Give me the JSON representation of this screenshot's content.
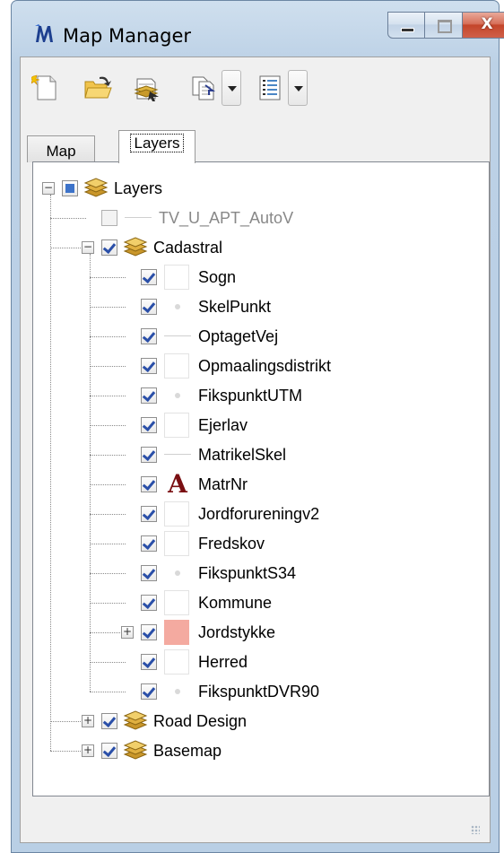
{
  "window": {
    "title": "Map Manager",
    "logo_icon": "map-manager-logo-icon",
    "caption_buttons": [
      "minimize",
      "maximize",
      "close"
    ],
    "close_glyph": "X"
  },
  "toolbar": {
    "buttons": [
      {
        "name": "new-map-icon"
      },
      {
        "name": "open-folder-icon"
      },
      {
        "name": "load-layer-icon"
      },
      {
        "name": "copy-document-icon",
        "has_dropdown": true
      },
      {
        "name": "list-view-icon",
        "has_dropdown": true
      }
    ]
  },
  "tabs": [
    {
      "label": "Map",
      "selected": false
    },
    {
      "label": "Layers",
      "selected": true
    }
  ],
  "tree": {
    "nodes": [
      {
        "label": "Layers",
        "level": 0,
        "type": "group",
        "check": "partial",
        "expander": "−"
      },
      {
        "label": "TV_U_APT_AutoV",
        "level": 1,
        "type": "layer",
        "symbol": "line",
        "check": "unchecked",
        "dim": true
      },
      {
        "label": "Cadastral",
        "level": 1,
        "type": "group",
        "check": "checked",
        "expander": "−"
      },
      {
        "label": "Sogn",
        "level": 2,
        "symbol": "box",
        "check": "checked"
      },
      {
        "label": "SkelPunkt",
        "level": 2,
        "symbol": "dot",
        "check": "checked"
      },
      {
        "label": "OptagetVej",
        "level": 2,
        "symbol": "line",
        "check": "checked"
      },
      {
        "label": "Opmaalingsdistrikt",
        "level": 2,
        "symbol": "box",
        "check": "checked"
      },
      {
        "label": "FikspunktUTM",
        "level": 2,
        "symbol": "dot",
        "check": "checked"
      },
      {
        "label": "Ejerlav",
        "level": 2,
        "symbol": "box",
        "check": "checked"
      },
      {
        "label": "MatrikelSkel",
        "level": 2,
        "symbol": "line",
        "check": "checked"
      },
      {
        "label": "MatrNr",
        "level": 2,
        "symbol": "text",
        "check": "checked",
        "symbol_text": "A"
      },
      {
        "label": "Jordforureningv2",
        "level": 2,
        "symbol": "box",
        "check": "checked"
      },
      {
        "label": "Fredskov",
        "level": 2,
        "symbol": "box",
        "check": "checked"
      },
      {
        "label": "FikspunktS34",
        "level": 2,
        "symbol": "dot",
        "check": "checked"
      },
      {
        "label": "Kommune",
        "level": 2,
        "symbol": "box",
        "check": "checked"
      },
      {
        "label": "Jordstykke",
        "level": 2,
        "symbol": "fill",
        "check": "checked",
        "expander": "+",
        "fill_color": "#f4aaa0"
      },
      {
        "label": "Herred",
        "level": 2,
        "symbol": "box",
        "check": "checked"
      },
      {
        "label": "FikspunktDVR90",
        "level": 2,
        "symbol": "dot",
        "check": "checked"
      },
      {
        "label": "Road Design",
        "level": 1,
        "type": "group",
        "check": "checked",
        "expander": "+"
      },
      {
        "label": "Basemap",
        "level": 1,
        "type": "group",
        "check": "checked",
        "expander": "+"
      }
    ]
  },
  "colors": {
    "title_bar": "#bcd1e6",
    "close_button": "#c4452a",
    "checkmark": "#2a4fa8",
    "matrnr_symbol": "#7a0f12"
  }
}
